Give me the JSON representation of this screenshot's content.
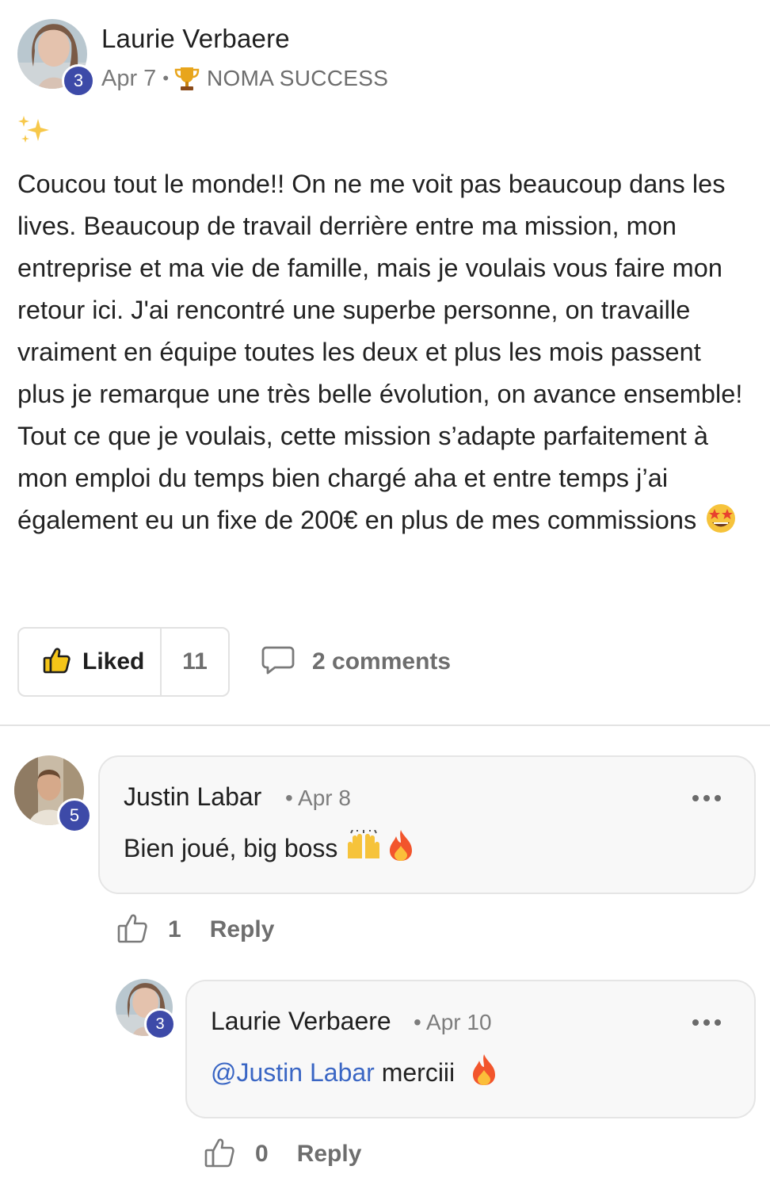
{
  "post": {
    "author": "Laurie Verbaere",
    "author_level": "3",
    "date": "Apr 7",
    "separator": "•",
    "category": "NOMA SUCCESS",
    "category_icon": "trophy-icon",
    "lead_emoji": "sparkles-icon",
    "body_text": "Coucou tout le monde!! On ne me voit pas beaucoup dans les lives. Beaucoup de travail derrière entre ma mission, mon entreprise et ma vie de famille, mais je voulais vous faire mon retour ici. J'ai rencontré une superbe personne, on travaille vraiment en équipe toutes les deux et plus les mois passent plus je remarque une très belle évolution, on avance ensemble! Tout ce que je voulais, cette mission s’adapte parfaitement à mon emploi du temps bien chargé aha et entre temps j’ai également eu un fixe de 200€ en plus de mes commissions",
    "body_end_emoji": "star-struck-emoji-icon",
    "like_label": "Liked",
    "like_count": "11",
    "comments_label": "2 comments"
  },
  "comments": [
    {
      "author": "Justin Labar",
      "author_level": "5",
      "date_prefix": "•",
      "date": "Apr 8",
      "text": "Bien joué, big boss",
      "emojis": [
        "raising-hands-emoji-icon",
        "fire-emoji-icon"
      ],
      "likes": "1",
      "reply_label": "Reply"
    },
    {
      "author": "Laurie Verbaere",
      "author_level": "3",
      "date_prefix": "•",
      "date": "Apr 10",
      "mention": "@Justin Labar",
      "text": "merciii",
      "emojis": [
        "fire-emoji-icon"
      ],
      "likes": "0",
      "reply_label": "Reply"
    }
  ],
  "colors": {
    "level_badge": "#3d4aa8",
    "mention": "#3a66c4",
    "muted_text": "#7a7a7a",
    "bubble_bg": "#f8f8f8"
  }
}
